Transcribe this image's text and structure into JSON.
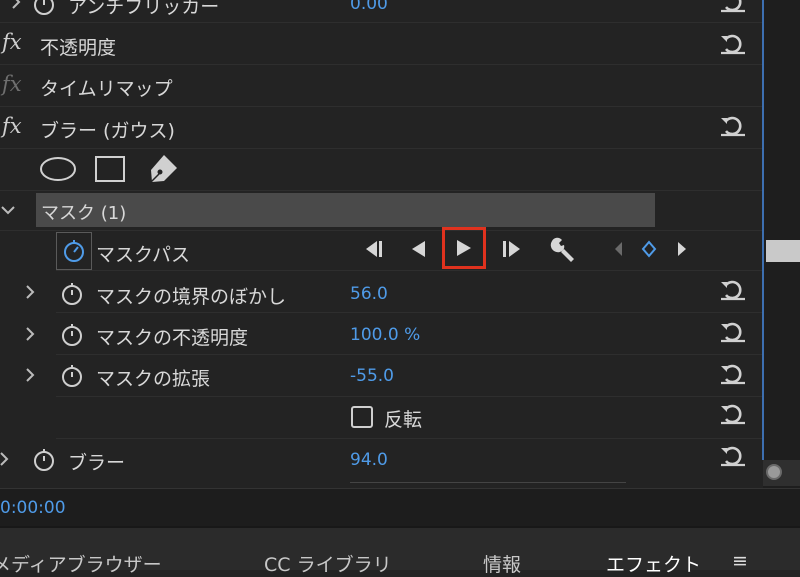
{
  "effects": {
    "anti_flicker": {
      "label": "アンチフリッカー",
      "value": "0.00"
    },
    "opacity": {
      "fx": "fx",
      "label": "不透明度"
    },
    "time_remap": {
      "fx": "fx",
      "label": "タイムリマップ"
    },
    "gaussian_blur": {
      "fx": "fx",
      "label": "ブラー (ガウス)"
    }
  },
  "mask": {
    "header_label": "マスク (1)",
    "path_label": "マスクパス",
    "feather": {
      "label": "マスクの境界のぼかし",
      "value": "56.0"
    },
    "opacity": {
      "label": "マスクの不透明度",
      "value": "100.0 %"
    },
    "expansion": {
      "label": "マスクの拡張",
      "value": "-55.0"
    },
    "inverted": {
      "label": "反転",
      "checked": false
    }
  },
  "blur": {
    "label": "ブラー",
    "value": "94.0"
  },
  "timecode": "0:00:00",
  "bottom_tabs": [
    {
      "label": "メディアブラウザー"
    },
    {
      "label": "CC ライブラリ"
    },
    {
      "label": "情報"
    },
    {
      "label": "エフェクト",
      "active": true
    },
    {
      "label": "≡"
    }
  ],
  "colors": {
    "accent_blue": "#4f9be8",
    "highlight_red": "#e0321e",
    "panel_bg": "#232323",
    "mask_header_bg": "#4a4a4a"
  },
  "icons": [
    "reset-icon",
    "stopwatch-icon",
    "ellipse-mask-icon",
    "rectangle-mask-icon",
    "pen-mask-icon",
    "wrench-icon",
    "keyframe-icon"
  ]
}
